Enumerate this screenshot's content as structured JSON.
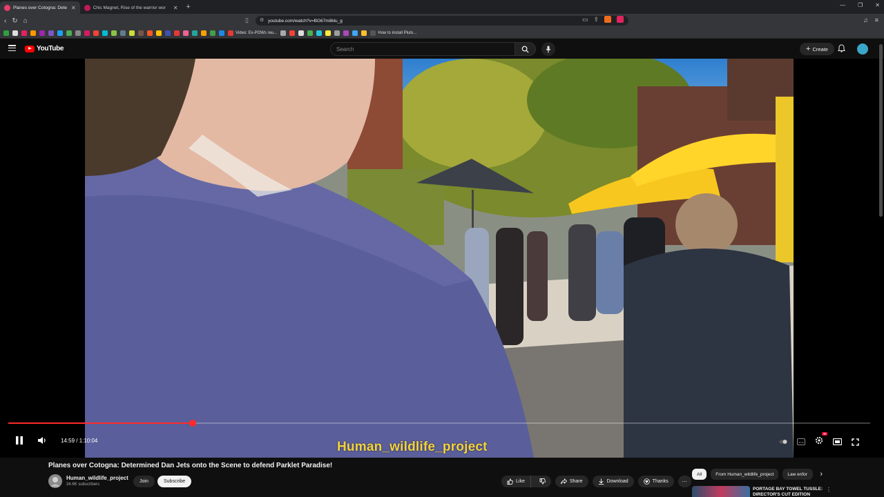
{
  "browser": {
    "tabs": [
      {
        "title": "Planes over Cotogna: Determ",
        "active": true
      },
      {
        "title": "Chic Magnet, Rise of the warrior wor",
        "active": false
      }
    ],
    "url": "youtube.com/watch?v=BG67m8klu_g",
    "bookmarks": [
      {
        "label": "Video: Ex-POWs reu..."
      },
      {
        "label": "How to install Pluto..."
      }
    ]
  },
  "header": {
    "logo_text": "YouTube",
    "search_placeholder": "Search",
    "create_label": "Create"
  },
  "player": {
    "current_time": "14:59",
    "duration": "1:10:04",
    "time_display": "14:59 / 1:10:04",
    "progress_fraction": 0.214,
    "caption_overlay": "Human_wildlife_project",
    "quality_badge": "4K"
  },
  "video": {
    "title": "Planes over Cotogna: Determined Dan Jets onto the Scene to defend Parklet Paradise!",
    "channel_name": "Human_wildlife_project",
    "subscribers": "34.6K subscribers",
    "join_label": "Join",
    "subscribe_label": "Subscribe",
    "actions": {
      "like": "Like",
      "share": "Share",
      "download": "Download",
      "thanks": "Thanks"
    }
  },
  "sidebar": {
    "chips": [
      "All",
      "From Human_wildlife_project",
      "Law enfor"
    ],
    "recommendation": {
      "title": "PORTAGE BAY TOWEL TUSSLE: DIRECTOR'S CUT EDITION"
    }
  },
  "colors": {
    "accent": "#ff0000",
    "progress": "#ff2a2a",
    "caption": "#f3d23b",
    "background": "#0f0f0f"
  }
}
